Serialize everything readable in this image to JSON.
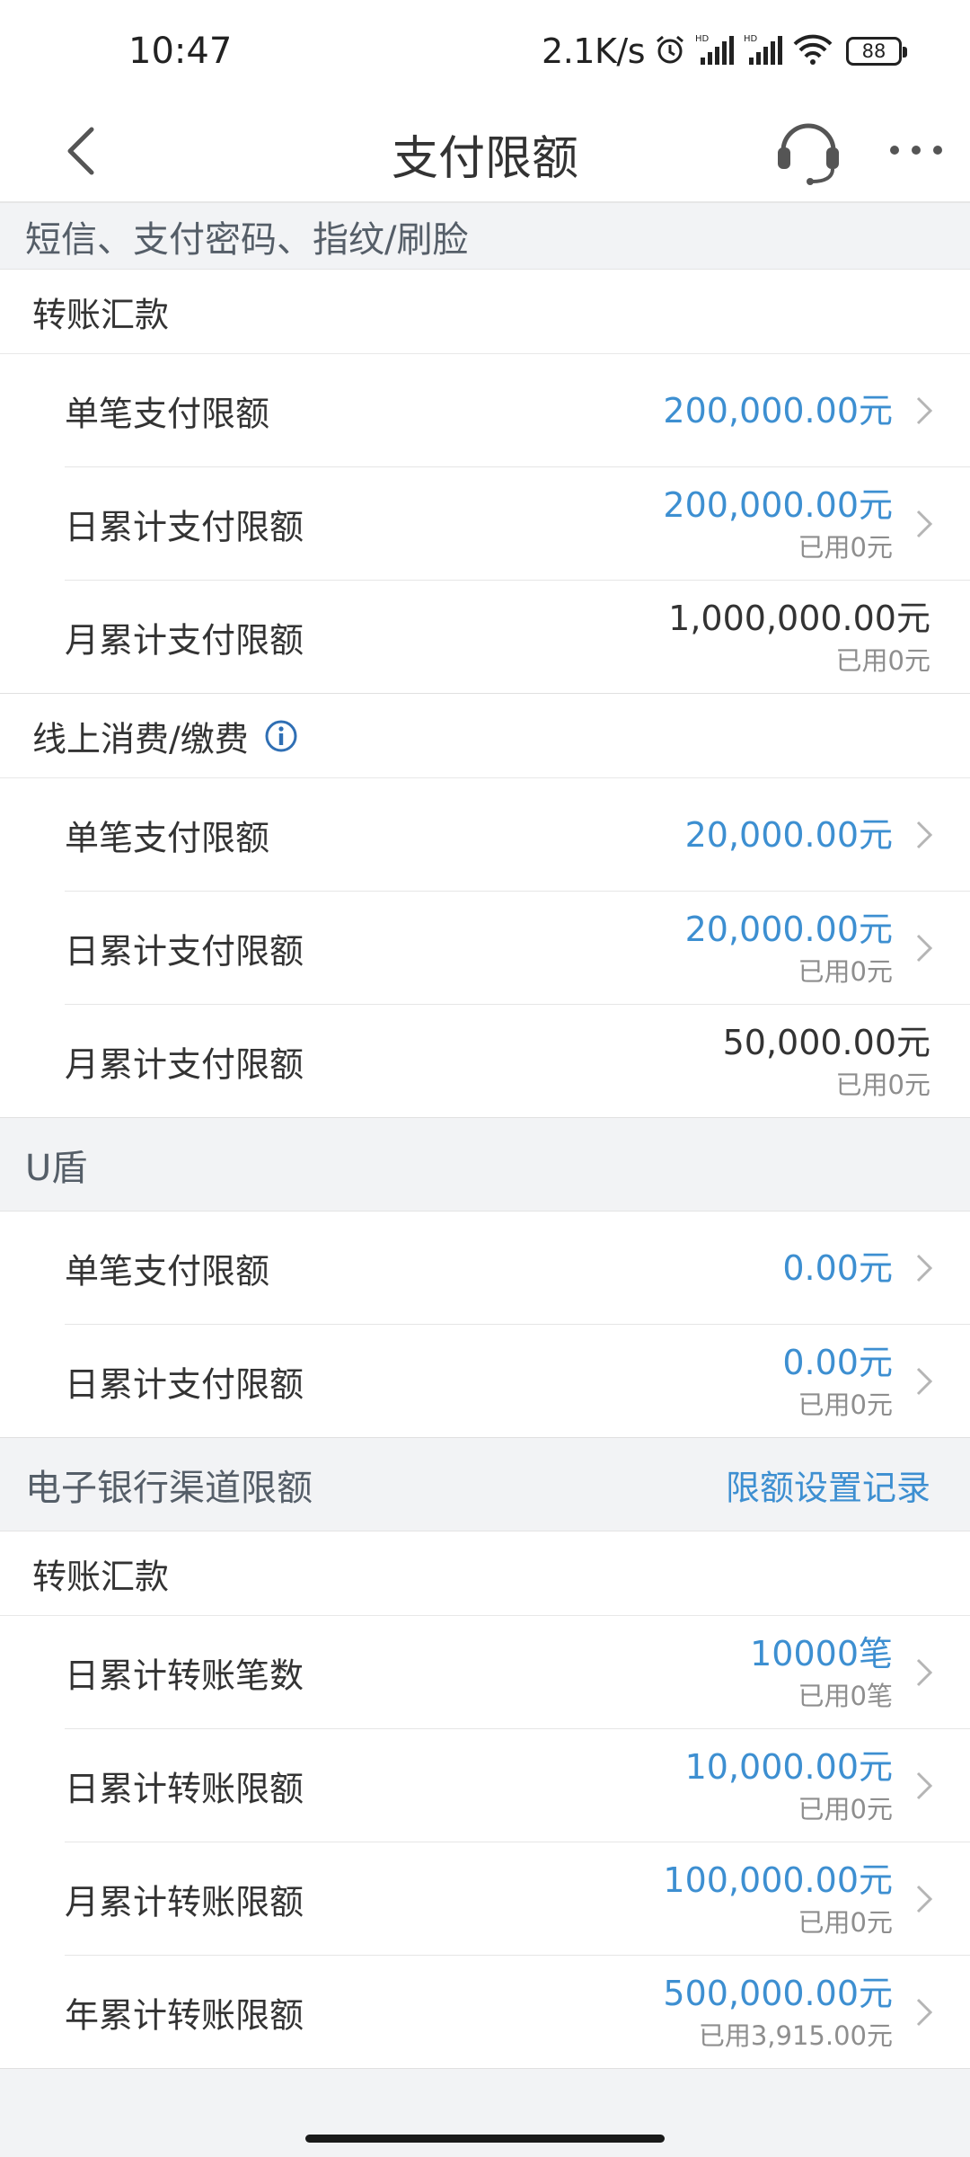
{
  "status_bar": {
    "time": "10:47",
    "net_speed": "2.1K/s",
    "battery": "88",
    "icons": [
      "alarm-icon",
      "signal-hd-icon",
      "signal-hd-icon",
      "wifi-icon",
      "battery-icon"
    ]
  },
  "nav": {
    "title": "支付限额",
    "icons": [
      "back-chevron-icon",
      "headset-service-icon",
      "more-dots-icon"
    ]
  },
  "colors": {
    "accent": "#3d8fd1",
    "text": "#333333",
    "muted": "#8e8e8e",
    "background": "#f2f3f5"
  },
  "sections": {
    "sms": {
      "title": "短信、支付密码、指纹/刷脸",
      "transfer": {
        "title": "转账汇款",
        "rows": [
          {
            "label": "单笔支付限额",
            "value": "200,000.00元"
          },
          {
            "label": "日累计支付限额",
            "value": "200,000.00元",
            "used": "已用0元"
          },
          {
            "label": "月累计支付限额",
            "value": "1,000,000.00元",
            "used": "已用0元"
          }
        ]
      },
      "online": {
        "title": "线上消费/缴费",
        "rows": [
          {
            "label": "单笔支付限额",
            "value": "20,000.00元"
          },
          {
            "label": "日累计支付限额",
            "value": "20,000.00元",
            "used": "已用0元"
          },
          {
            "label": "月累计支付限额",
            "value": "50,000.00元",
            "used": "已用0元"
          }
        ]
      }
    },
    "ushield": {
      "title": "U盾",
      "rows": [
        {
          "label": "单笔支付限额",
          "value": "0.00元"
        },
        {
          "label": "日累计支付限额",
          "value": "0.00元",
          "used": "已用0元"
        }
      ]
    },
    "ebank": {
      "title": "电子银行渠道限额",
      "link": "限额设置记录",
      "transfer": {
        "title": "转账汇款",
        "rows": [
          {
            "label": "日累计转账笔数",
            "value": "10000笔",
            "used": "已用0笔"
          },
          {
            "label": "日累计转账限额",
            "value": "10,000.00元",
            "used": "已用0元"
          },
          {
            "label": "月累计转账限额",
            "value": "100,000.00元",
            "used": "已用0元"
          },
          {
            "label": "年累计转账限额",
            "value": "500,000.00元",
            "used": "已用3,915.00元"
          }
        ]
      }
    }
  }
}
